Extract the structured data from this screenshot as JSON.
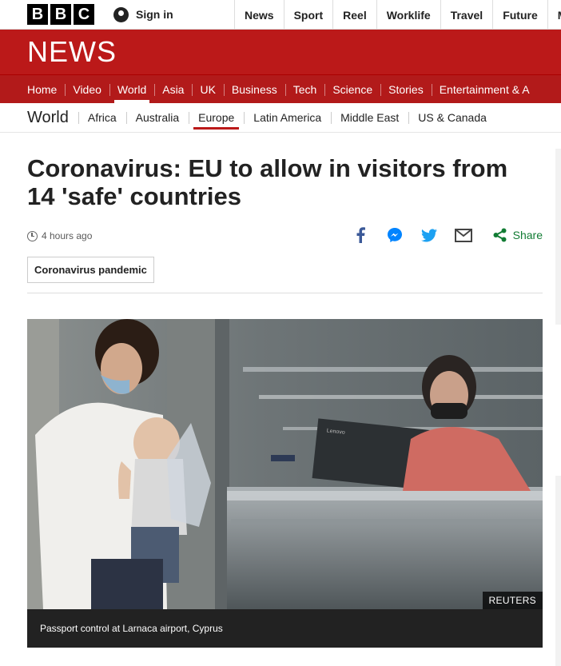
{
  "brand": {
    "letters": [
      "B",
      "B",
      "C"
    ]
  },
  "account": {
    "signin_label": "Sign in"
  },
  "top_nav": [
    "News",
    "Sport",
    "Reel",
    "Worklife",
    "Travel",
    "Future",
    "Mc"
  ],
  "news_wordmark": "NEWS",
  "red_nav": [
    "Home",
    "Video",
    "World",
    "Asia",
    "UK",
    "Business",
    "Tech",
    "Science",
    "Stories",
    "Entertainment & A"
  ],
  "red_nav_active": "World",
  "sub_nav": {
    "section": "World",
    "items": [
      "Africa",
      "Australia",
      "Europe",
      "Latin America",
      "Middle East",
      "US & Canada"
    ],
    "active": "Europe"
  },
  "article": {
    "headline": "Coronavirus: EU to allow in visitors from 14 'safe' countries",
    "timestamp": "4 hours ago",
    "share_label": "Share",
    "tag": "Coronavirus pandemic",
    "image_caption": "Passport control at Larnaca airport, Cyprus",
    "image_credit": "REUTERS",
    "image_monitor_text": "Lenovo"
  },
  "share_icons": [
    "facebook-icon",
    "messenger-icon",
    "twitter-icon",
    "email-icon",
    "share-icon"
  ],
  "colors": {
    "brand_red": "#bb1919",
    "share_green": "#127c34",
    "facebook_blue": "#3b5998",
    "messenger_blue": "#0084ff",
    "twitter_blue": "#1da1f2"
  }
}
